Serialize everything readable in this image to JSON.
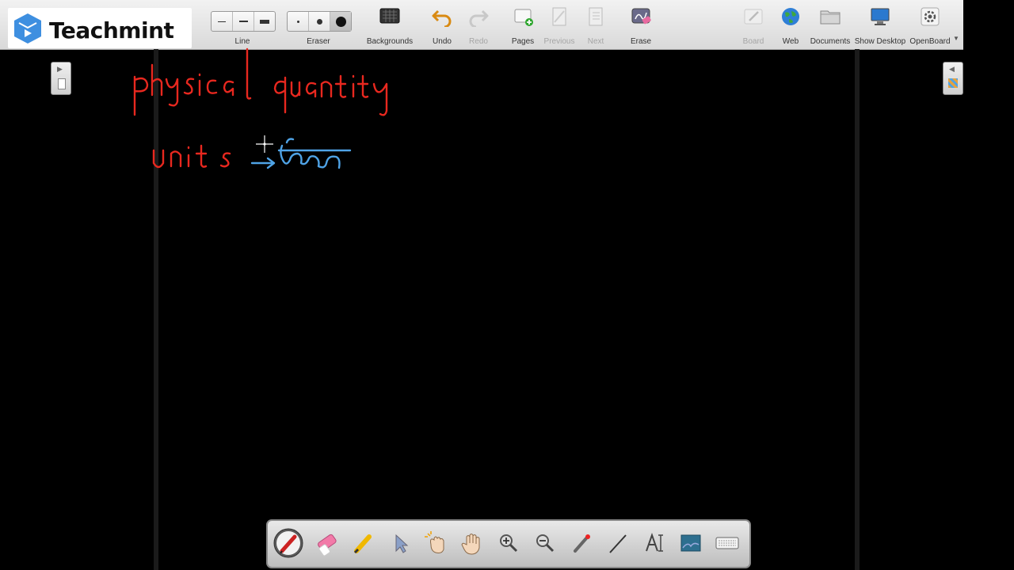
{
  "brand": {
    "name": "Teachmint",
    "color": "#3e8fe0"
  },
  "toolbar": {
    "line_label": "Line",
    "eraser_label": "Eraser",
    "backgrounds_label": "Backgrounds",
    "undo_label": "Undo",
    "redo_label": "Redo",
    "pages_label": "Pages",
    "previous_label": "Previous",
    "next_label": "Next",
    "erase_label": "Erase",
    "board_label": "Board",
    "web_label": "Web",
    "documents_label": "Documents",
    "show_desktop_label": "Show Desktop",
    "openboard_label": "OpenBoard"
  },
  "board": {
    "background_color": "#000000",
    "ink_red": "#e8281f",
    "ink_blue": "#4fa3e6",
    "handwriting": [
      {
        "text": "physical quantity",
        "color": "red"
      },
      {
        "text": "Units",
        "color": "red"
      },
      {
        "text": "→ ইকাই",
        "color": "blue"
      }
    ]
  },
  "palette": {
    "tools": [
      "pen-icon",
      "eraser-icon",
      "marker-icon",
      "selector-icon",
      "interact-icon",
      "hand-icon",
      "zoom-in-icon",
      "zoom-out-icon",
      "laser-pointer-icon",
      "line-icon",
      "text-icon",
      "capture-icon",
      "keyboard-icon"
    ],
    "selected": "pen-icon"
  }
}
